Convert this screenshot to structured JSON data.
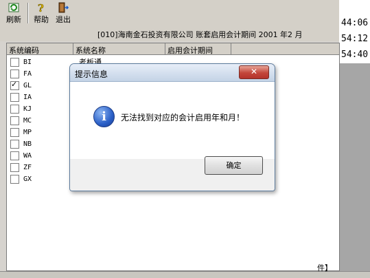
{
  "toolbar": {
    "refresh_label": "刷新",
    "help_label": "帮助",
    "exit_label": "退出"
  },
  "company_info": "[010]海南金石投资有限公司  账套启用会计期间 2001 年2 月",
  "table": {
    "columns": [
      "系统编码",
      "系统名称",
      "启用会计期间"
    ],
    "rows": [
      {
        "code": "BI",
        "checked": false
      },
      {
        "code": "FA",
        "checked": false
      },
      {
        "code": "GL",
        "checked": true
      },
      {
        "code": "IA",
        "checked": false
      },
      {
        "code": "KJ",
        "checked": false
      },
      {
        "code": "MC",
        "checked": false
      },
      {
        "code": "MP",
        "checked": false
      },
      {
        "code": "NB",
        "checked": false
      },
      {
        "code": "WA",
        "checked": false
      },
      {
        "code": "ZF",
        "checked": false
      },
      {
        "code": "GX",
        "checked": false
      }
    ],
    "first_row_name_partial": "老板通"
  },
  "background_times": [
    "44:06",
    "54:12",
    "54:40"
  ],
  "bottom_tab_partial": "件】",
  "dialog": {
    "title": "提示信息",
    "close_glyph": "✕",
    "icon_glyph": "i",
    "message": "无法找到对应的会计启用年和月！",
    "ok_label": "确定"
  }
}
